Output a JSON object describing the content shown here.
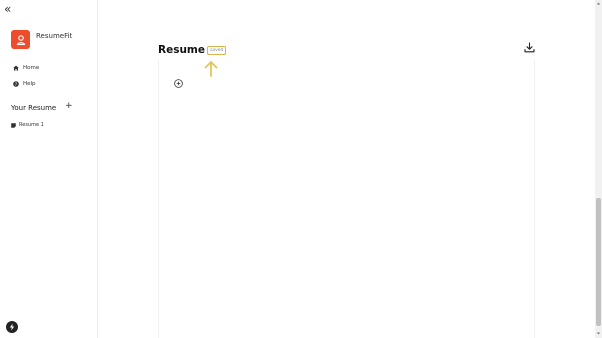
{
  "sidebar": {
    "collapse_glyph": "«",
    "brand": {
      "name": "ResumeFit",
      "icon": "user-badge-icon",
      "color": "#ee4d2d"
    },
    "nav": [
      {
        "label": "Home",
        "icon": "home-icon"
      },
      {
        "label": "Help",
        "icon": "help-icon"
      }
    ],
    "section_title": "Your Resume",
    "add_glyph": "+",
    "resumes": [
      {
        "label": "Resume 1",
        "icon": "document-icon"
      }
    ],
    "bottom_icon": "lightning-icon"
  },
  "main": {
    "title": "Resume",
    "status": "saved",
    "status_color": "#d8b24a",
    "download_icon": "download-icon",
    "add_section_icon": "plus-circle-icon"
  }
}
